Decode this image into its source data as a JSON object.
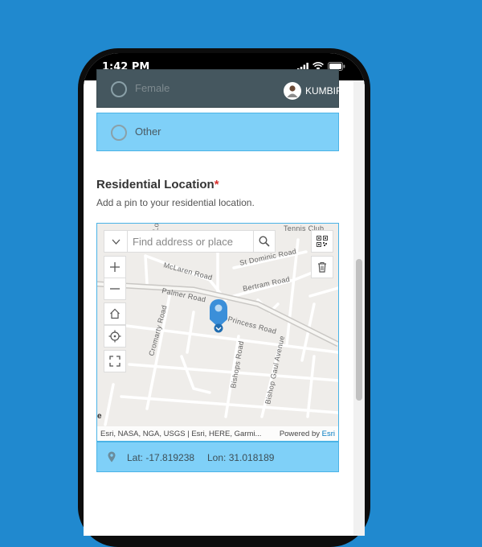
{
  "status_bar": {
    "time": "1:42 PM"
  },
  "user": {
    "name": "KUMBIRAI"
  },
  "gender_options": [
    {
      "label": "Female",
      "selected": false
    },
    {
      "label": "Other",
      "selected": false
    }
  ],
  "section": {
    "title": "Residential Location",
    "required_mark": "*",
    "description": "Add a pin to your residential location."
  },
  "map": {
    "search_placeholder": "Find address or place",
    "attribution": "Esri, NASA, NGA, USGS | Esri, HERE, Garmi...",
    "powered_by": "Powered by",
    "powered_by_brand": "Esri",
    "edge_letter": "e",
    "road_labels": {
      "tennis_club": "Tennis Club",
      "st_dominic": "St Dominic Road",
      "mclaren": "McLaren Road",
      "bertram": "Bertram Road",
      "palmer": "Palmer Road",
      "princess": "Princess Road",
      "cromarty": "Cromarty Road",
      "bishops": "Bishops Road",
      "bishop_gaul": "Bishop Gaul Avenue",
      "lo": "Lo"
    },
    "controls": [
      "zoom-in",
      "zoom-out",
      "home",
      "locate",
      "fullscreen",
      "qr-code",
      "delete"
    ]
  },
  "coordinates": {
    "lat_text": "Lat: -17.819238",
    "lon_text": "Lon: 31.018189"
  },
  "colors": {
    "background": "#2089cf",
    "option_fill": "#7fd0f8",
    "option_border": "#4ab3e6",
    "required": "#d9302e",
    "pin": "#3b8fd9",
    "esri_link": "#0079c1"
  }
}
